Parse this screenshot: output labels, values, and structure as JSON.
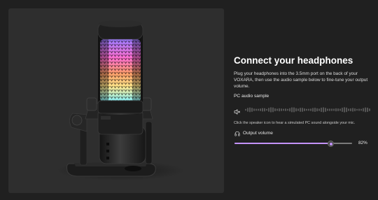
{
  "panel": {
    "title": "Connect your headphones",
    "description": "Plug your headphones into the 3.5mm port on the back of your VOXARA, then use the audio sample below to fine-tune your output volume.",
    "sample_label": "PC audio sample",
    "hint": "Click the speaker icon to hear a simulated PC sound alongside your mic.",
    "volume_label": "Output volume",
    "volume_value": "82%",
    "volume_level": 0.82
  },
  "icons": {
    "speaker": "speaker-muted-icon",
    "headphones": "headphones-icon"
  },
  "colors": {
    "background": "#202020",
    "card": "#2e2e2e",
    "accent": "#c493ff",
    "track": "#7a7a7a",
    "text": "#ffffff"
  }
}
